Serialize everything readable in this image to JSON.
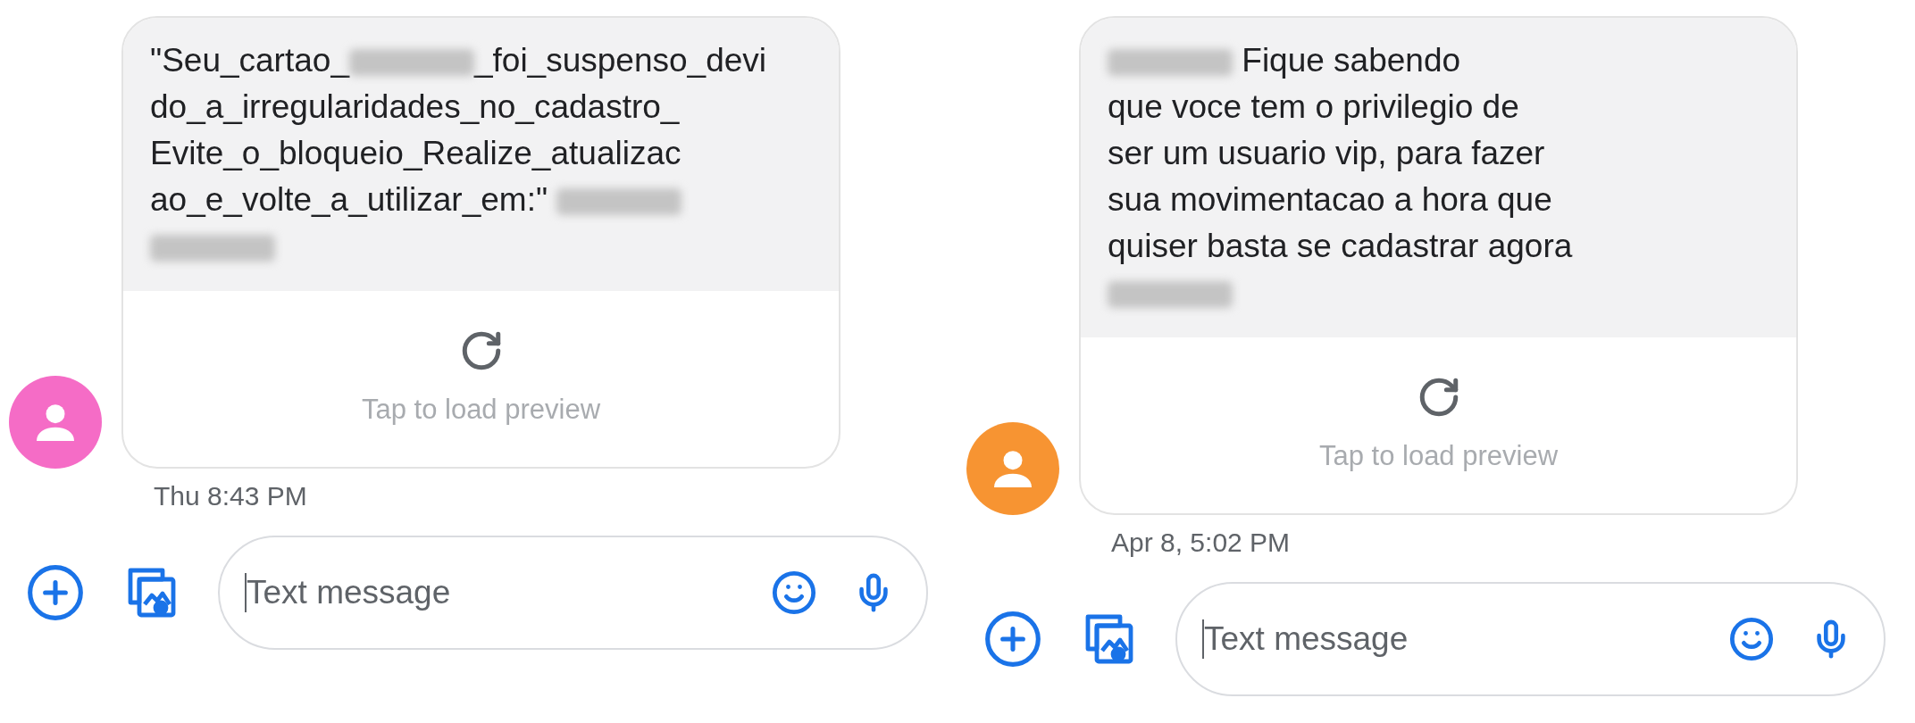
{
  "conversations": [
    {
      "avatar": {
        "color": "#f56cc6"
      },
      "message": {
        "lines": [
          [
            {
              "kind": "text",
              "text": "\"Seu_cartao_"
            },
            {
              "kind": "redacted"
            },
            {
              "kind": "text",
              "text": "_foi_suspenso_devi"
            }
          ],
          [
            {
              "kind": "text",
              "text": "do_a_irregularidades_no_cadastro_"
            }
          ],
          [
            {
              "kind": "text",
              "text": "Evite_o_bloqueio_Realize_atualizac"
            }
          ],
          [
            {
              "kind": "text",
              "text": "ao_e_volte_a_utilizar_em:\" "
            },
            {
              "kind": "redacted"
            }
          ],
          [
            {
              "kind": "redacted"
            }
          ]
        ],
        "preview_label": "Tap to load preview",
        "time": "Thu 8:43 PM"
      },
      "composer": {
        "placeholder": "Text message"
      }
    },
    {
      "avatar": {
        "color": "#f79432"
      },
      "message": {
        "lines": [
          [
            {
              "kind": "redacted"
            },
            {
              "kind": "text",
              "text": " Fique sabendo"
            }
          ],
          [
            {
              "kind": "text",
              "text": "que voce tem o privilegio de"
            }
          ],
          [
            {
              "kind": "text",
              "text": "ser um usuario vip, para fazer"
            }
          ],
          [
            {
              "kind": "text",
              "text": "sua movimentacao a hora que"
            }
          ],
          [
            {
              "kind": "text",
              "text": "quiser basta se cadastrar agora"
            }
          ],
          [
            {
              "kind": "redacted"
            }
          ]
        ],
        "preview_label": "Tap to load preview",
        "time": "Apr 8, 5:02 PM"
      },
      "composer": {
        "placeholder": "Text message"
      }
    }
  ]
}
